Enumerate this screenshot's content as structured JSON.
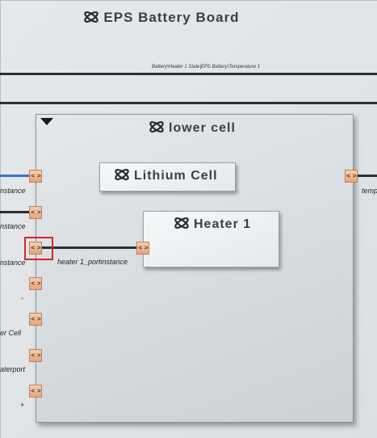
{
  "board": {
    "title": "EPS Battery Board"
  },
  "connection_label": "Battery\\Heater 1 State|EPS Battery\\Temperature 1",
  "lower_cell": {
    "title": "lower cell"
  },
  "blocks": {
    "lithium_cell": "Lithium Cell",
    "heater_1": "Heater 1"
  },
  "port_glyph": "< >",
  "left_port_labels": [
    "nstance",
    "nstance",
    "nstance",
    "-",
    "er Cell",
    "aterport",
    "+"
  ],
  "heater_port_label": "heater 1_portinstance",
  "right_port_label": "temp",
  "colors": {
    "wire_blue": "#3a6fd8",
    "wire_dark": "#2d3033",
    "highlight": "#d9232a",
    "port_fill": "#eeb68e"
  }
}
